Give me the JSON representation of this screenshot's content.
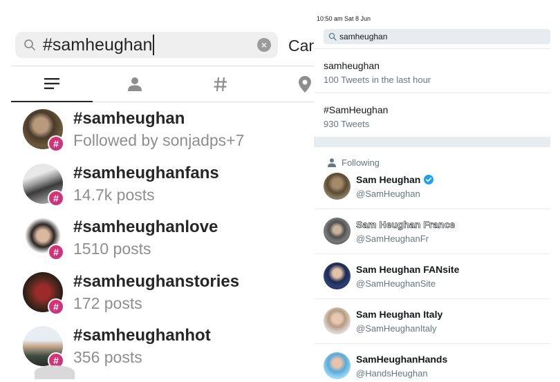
{
  "instagram": {
    "search": {
      "query": "#samheughan",
      "cancel_label": "Can"
    },
    "tabs": [
      {
        "icon": "top-icon",
        "active": true
      },
      {
        "icon": "people-icon",
        "active": false
      },
      {
        "icon": "hashtag-icon",
        "active": false
      },
      {
        "icon": "location-pin-icon",
        "active": false
      }
    ],
    "results": [
      {
        "name": "#samheughan",
        "subtitle": "Followed by sonjadps+7"
      },
      {
        "name": "#samheughanfans",
        "subtitle": "14.7k posts"
      },
      {
        "name": "#samheughanlove",
        "subtitle": "1510 posts"
      },
      {
        "name": "#samheughanstories",
        "subtitle": "172 posts"
      },
      {
        "name": "#samheughanhot",
        "subtitle": "356 posts"
      }
    ],
    "badge_glyph": "#",
    "colors": {
      "badge": "#e1306c",
      "text": "#262626",
      "muted": "#8e8e8e"
    }
  },
  "twitter": {
    "status_bar": "10:50 am  Sat 8 Jun",
    "search": {
      "query": "samheughan"
    },
    "suggestions": [
      {
        "title": "samheughan",
        "subtitle": "100 Tweets in the last hour"
      },
      {
        "title": "#SamHeughan",
        "subtitle": "930 Tweets"
      }
    ],
    "following_label": "Following",
    "users": [
      {
        "name": "Sam Heughan",
        "handle": "@SamHeughan",
        "verified": true
      },
      {
        "name": "Sam Heughan France",
        "handle": "@SamHeughanFr",
        "verified": false
      },
      {
        "name": "Sam Heughan FANsite",
        "handle": "@SamHeughanSite",
        "verified": false
      },
      {
        "name": "Sam Heughan Italy",
        "handle": "@SamHeughanItaly",
        "verified": false
      },
      {
        "name": "SamHeughanHands",
        "handle": "@HandsHeughan",
        "verified": false
      }
    ],
    "colors": {
      "verified": "#1da1f2",
      "text": "#14171a",
      "muted": "#657786"
    }
  }
}
